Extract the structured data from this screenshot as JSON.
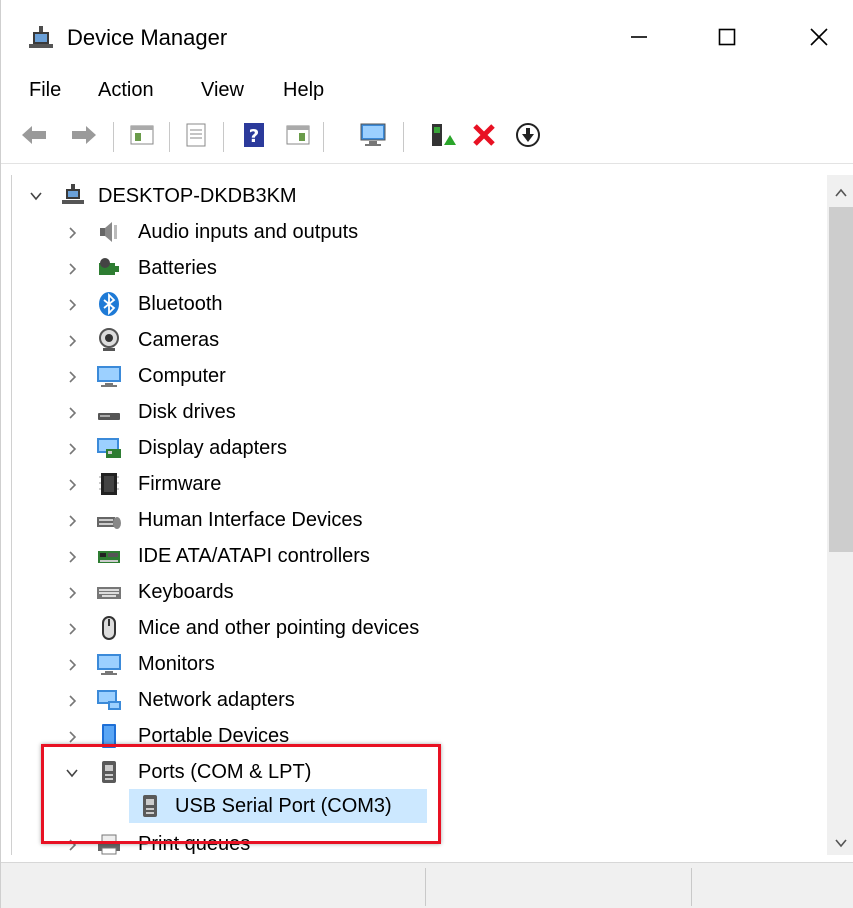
{
  "window": {
    "title": "Device Manager",
    "controls": {
      "minimize_icon": "minimize-icon",
      "maximize_icon": "maximize-icon",
      "close_icon": "close-icon"
    }
  },
  "menu": [
    "File",
    "Action",
    "View",
    "Help"
  ],
  "toolbar": {
    "buttons": [
      {
        "name": "back-arrow-icon"
      },
      {
        "name": "forward-arrow-icon"
      },
      {
        "name": "show-hide-console-tree-icon"
      },
      {
        "name": "properties-icon"
      },
      {
        "name": "help-icon"
      },
      {
        "name": "action-pane-icon"
      },
      {
        "name": "scan-hardware-icon"
      },
      {
        "name": "update-driver-icon"
      },
      {
        "name": "uninstall-device-icon"
      },
      {
        "name": "disable-device-icon"
      }
    ]
  },
  "tree": {
    "root": {
      "label": "DESKTOP-DKDB3KM",
      "expanded": true
    },
    "items": [
      {
        "label": "Audio inputs and outputs",
        "icon": "speaker-icon"
      },
      {
        "label": "Batteries",
        "icon": "battery-icon"
      },
      {
        "label": "Bluetooth",
        "icon": "bluetooth-icon"
      },
      {
        "label": "Cameras",
        "icon": "webcam-icon"
      },
      {
        "label": "Computer",
        "icon": "monitor-icon"
      },
      {
        "label": "Disk drives",
        "icon": "disk-drive-icon"
      },
      {
        "label": "Display adapters",
        "icon": "display-adapter-icon"
      },
      {
        "label": "Firmware",
        "icon": "chip-icon"
      },
      {
        "label": "Human Interface Devices",
        "icon": "hid-icon"
      },
      {
        "label": "IDE ATA/ATAPI controllers",
        "icon": "ide-controller-icon"
      },
      {
        "label": "Keyboards",
        "icon": "keyboard-icon"
      },
      {
        "label": "Mice and other pointing devices",
        "icon": "mouse-icon"
      },
      {
        "label": "Monitors",
        "icon": "monitor-icon"
      },
      {
        "label": "Network adapters",
        "icon": "network-icon"
      },
      {
        "label": "Portable Devices",
        "icon": "portable-device-icon"
      },
      {
        "label": "Ports (COM & LPT)",
        "icon": "port-icon",
        "expanded": true
      },
      {
        "label": "Print queues",
        "icon": "printer-icon"
      }
    ],
    "ports_children": [
      {
        "label": "USB Serial Port (COM3)",
        "icon": "port-icon",
        "selected": true
      }
    ]
  },
  "colors": {
    "highlight": "#e81123",
    "selection": "#cce8ff",
    "accent": "#0078d7"
  }
}
